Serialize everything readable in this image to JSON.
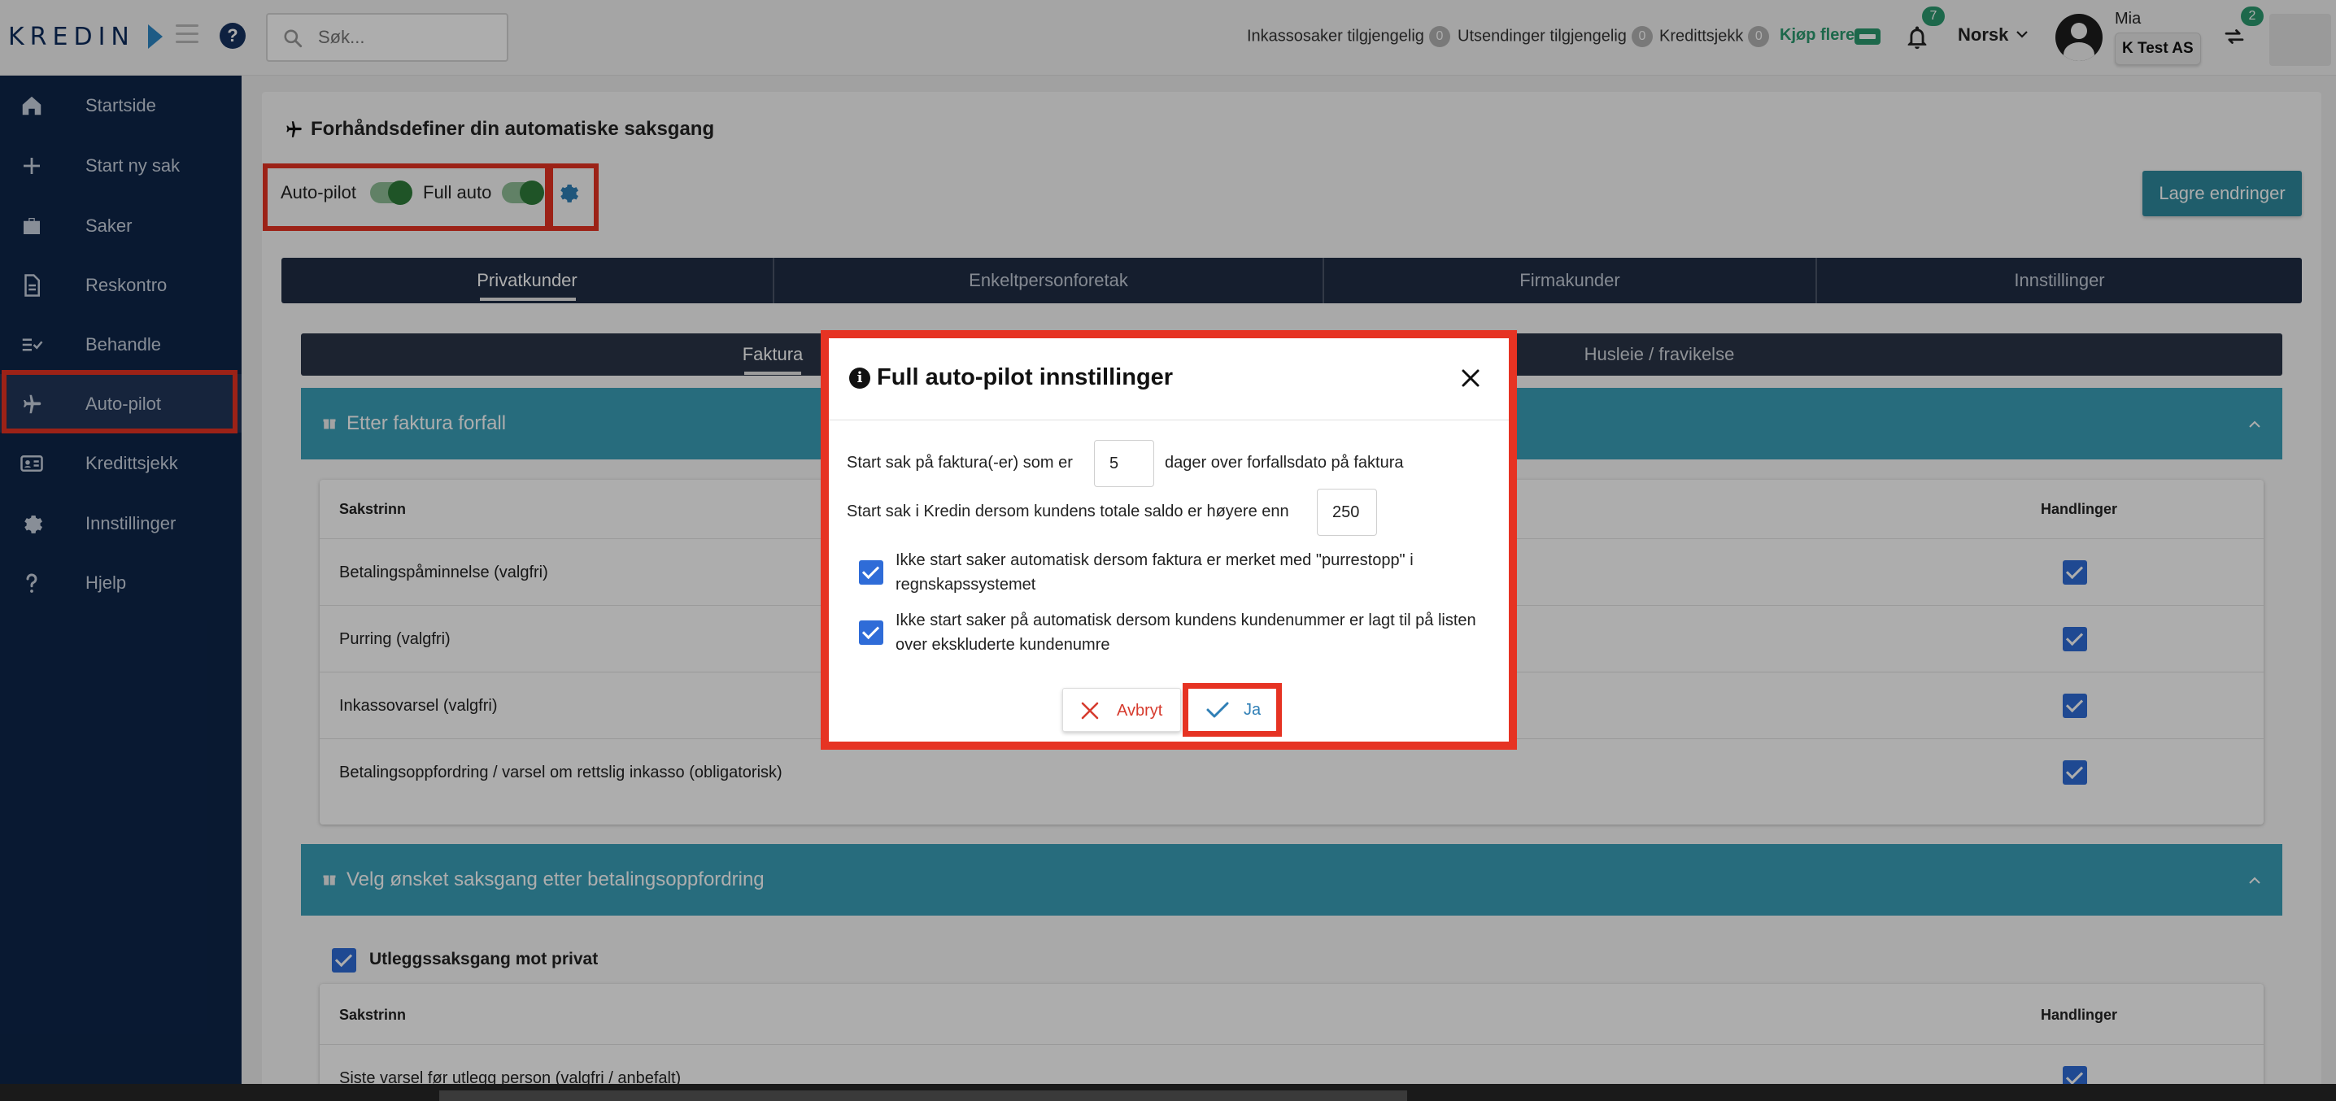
{
  "header": {
    "logo": "KREDIN",
    "search_placeholder": "Søk...",
    "stats": [
      {
        "label": "Inkassosaker tilgjengelig",
        "count": "0"
      },
      {
        "label": "Utsendinger tilgjengelig",
        "count": "0"
      },
      {
        "label": "Kredittsjekk",
        "count": "0"
      }
    ],
    "buy_more": "Kjøp flere",
    "notifications_count": "7",
    "language": "Norsk",
    "user_name": "Mia",
    "company": "K Test AS",
    "switch_count": "2"
  },
  "sidebar": {
    "items": [
      {
        "label": "Startside",
        "icon": "home-icon"
      },
      {
        "label": "Start ny sak",
        "icon": "plus-icon"
      },
      {
        "label": "Saker",
        "icon": "briefcase-icon"
      },
      {
        "label": "Reskontro",
        "icon": "document-icon"
      },
      {
        "label": "Behandle",
        "icon": "checklist-icon"
      },
      {
        "label": "Auto-pilot",
        "icon": "airplane-icon",
        "active": true
      },
      {
        "label": "Kredittsjekk",
        "icon": "id-card-icon"
      },
      {
        "label": "Innstillinger",
        "icon": "gear-icon"
      },
      {
        "label": "Hjelp",
        "icon": "question-icon"
      }
    ]
  },
  "page": {
    "title": "Forhåndsdefiner din automatiske saksgang",
    "autopilot_label": "Auto-pilot",
    "fullauto_label": "Full auto",
    "save_label": "Lagre endringer",
    "tabs": [
      "Privatkunder",
      "Enkeltpersonforetak",
      "Firmakunder",
      "Innstillinger"
    ],
    "subtabs": [
      "Faktura",
      "Husleie / fravikelse"
    ],
    "section1": {
      "title": "Etter faktura forfall",
      "col_step": "Sakstrinn",
      "col_actions": "Handlinger",
      "rows": [
        "Betalingspåminnelse (valgfri)",
        "Purring (valgfri)",
        "Inkassovarsel (valgfri)",
        "Betalingsoppfordring / varsel om rettslig inkasso (obligatorisk)"
      ]
    },
    "section2": {
      "title": "Velg ønsket saksgang etter betalingsoppfordring",
      "option_label": "Utleggssaksgang mot privat",
      "col_step": "Sakstrinn",
      "col_actions": "Handlinger",
      "rows": [
        "Siste varsel før utlegg person (valgfri / anbefalt)"
      ]
    }
  },
  "modal": {
    "title": "Full auto-pilot innstillinger",
    "line1_pre": "Start sak på faktura(-er) som er",
    "line1_value": "5",
    "line1_post": "dager over forfallsdato på faktura",
    "line2_pre": "Start sak i Kredin dersom kundens totale saldo er høyere enn",
    "line2_value": "250",
    "check1": "Ikke start saker automatisk dersom faktura er merket med \"purrestopp\" i regnskapssystemet",
    "check2": "Ikke start saker på automatisk dersom kundens kundenummer er lagt til på listen over ekskluderte kundenumre",
    "cancel_label": "Avbryt",
    "confirm_label": "Ja"
  },
  "colors": {
    "sidebar_bg": "#0e2549",
    "accent_teal": "#3aa0b8",
    "highlight_red": "#e63323",
    "checkbox_blue": "#2f6cd8",
    "success_green": "#2b9a6f"
  }
}
